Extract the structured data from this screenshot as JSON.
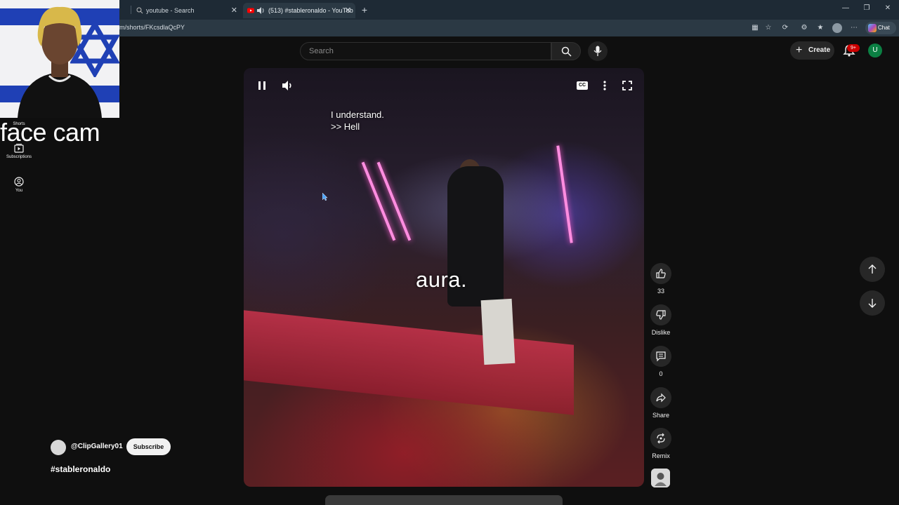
{
  "browser": {
    "tabs": [
      {
        "title": "youtube - Search",
        "active": false
      },
      {
        "title": "(513) #stableronaldo - YouTub",
        "active": true
      }
    ],
    "new_tab_symbol": "+",
    "url": "m/shorts/FKcsdlaQcPY",
    "chat_label": "Chat",
    "window_controls": [
      "minimize-icon",
      "restore-icon",
      "close-icon"
    ]
  },
  "youtube": {
    "search_placeholder": "Search",
    "create_label": "Create",
    "notification_badge": "9+",
    "account_initial": "U",
    "nav": [
      {
        "label": "Shorts",
        "icon": "shorts-icon"
      },
      {
        "label": "Subscriptions",
        "icon": "subscriptions-icon"
      },
      {
        "label": "You",
        "icon": "account-icon"
      }
    ]
  },
  "overlay": {
    "facecam_label": "face cam"
  },
  "video": {
    "caption_line1": "I understand.",
    "caption_line2": ">> Hell",
    "caption_center": "aura.",
    "state": "playing",
    "cc_label": "CC"
  },
  "actions": {
    "like_count": "33",
    "dislike_label": "Dislike",
    "comment_count": "0",
    "share_label": "Share",
    "remix_label": "Remix"
  },
  "channel": {
    "handle": "@ClipGallery01",
    "subscribe_label": "Subscribe",
    "title": "#stableronaldo"
  },
  "colors": {
    "page_bg": "#0f0f0f",
    "chrome_bg": "#1e2a35",
    "badge_red": "#cc0000",
    "avatar_green": "#0b8043"
  }
}
